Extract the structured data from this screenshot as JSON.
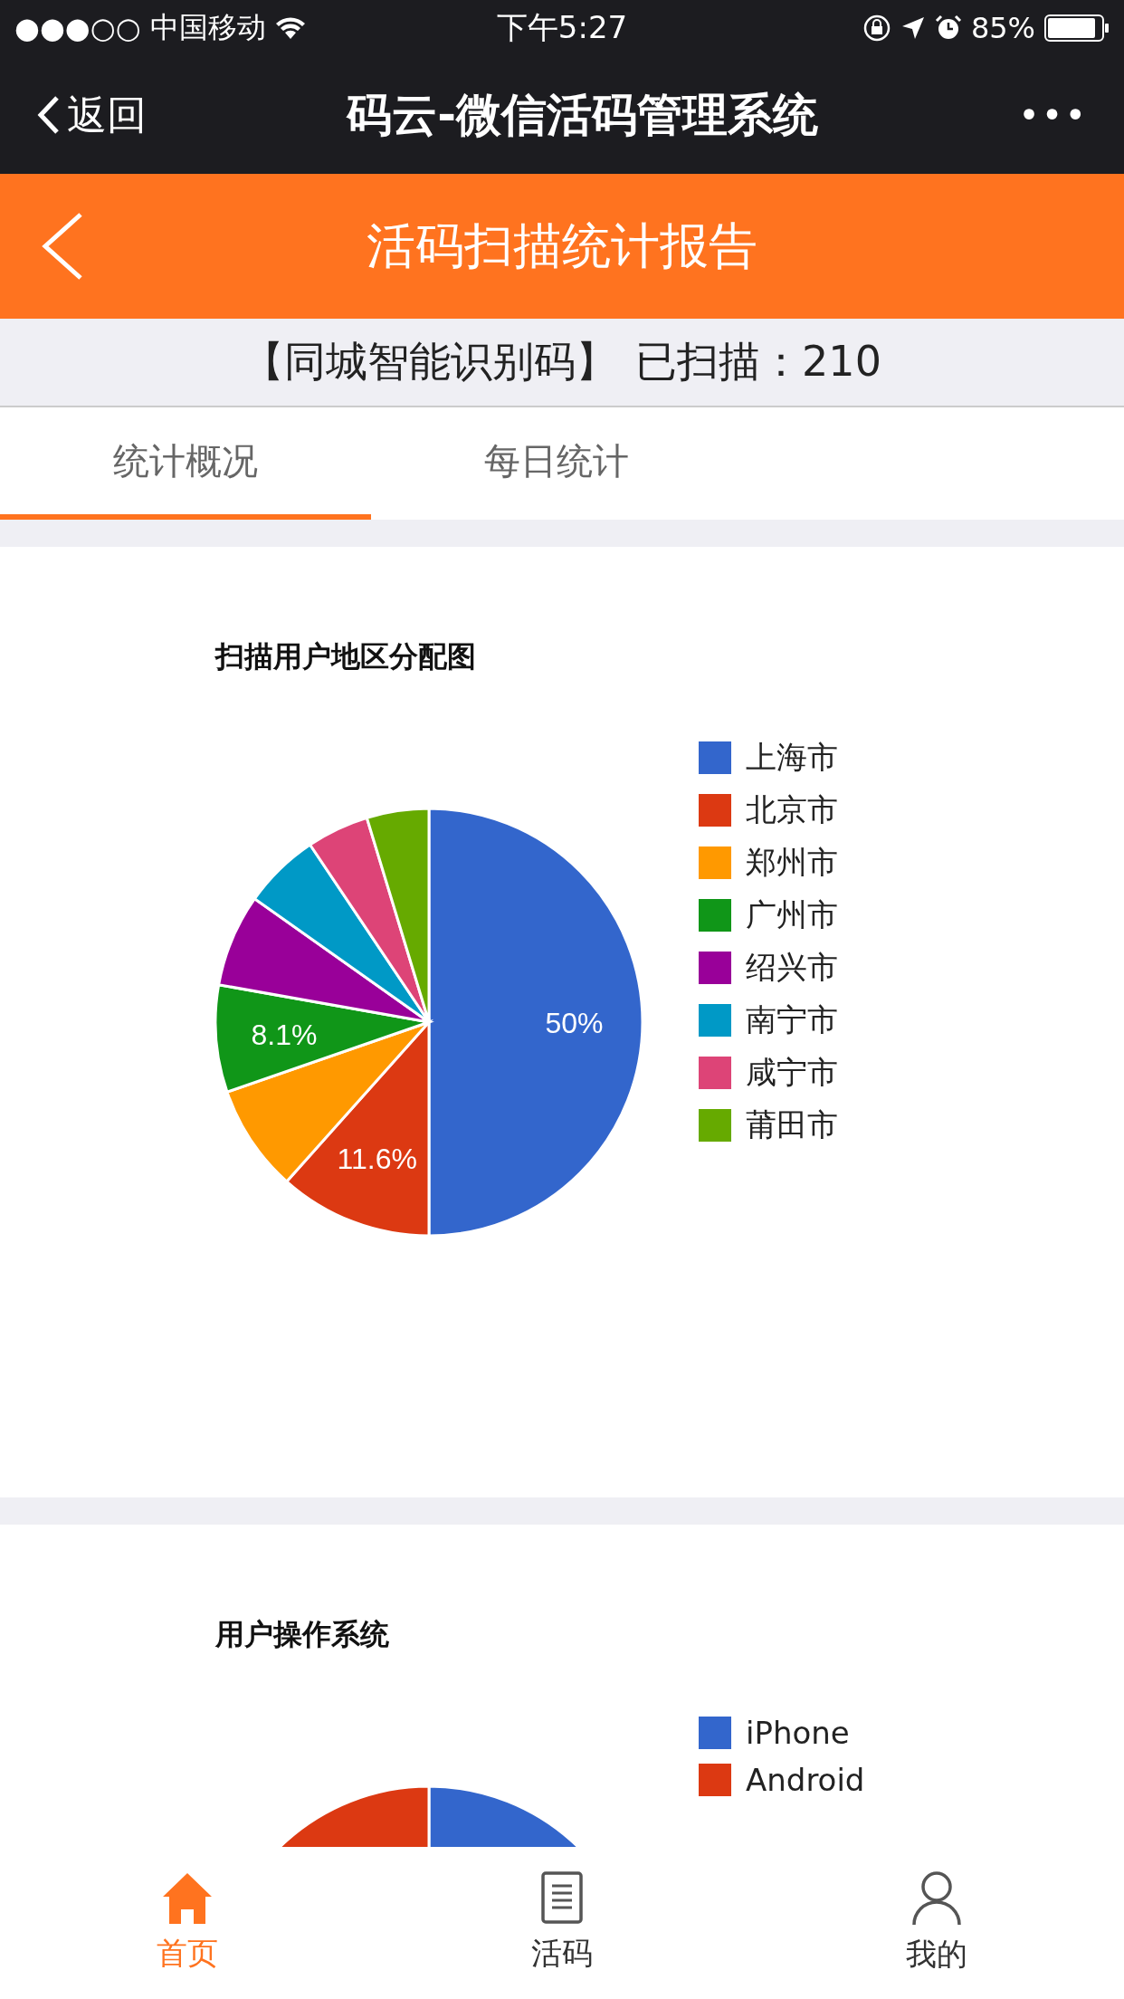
{
  "status_bar": {
    "signal": "●●●○○",
    "carrier": "中国移动",
    "time": "下午5:27",
    "battery": "85%"
  },
  "nav_bar": {
    "back": "返回",
    "title": "码云-微信活码管理系统",
    "more": "•••"
  },
  "header": {
    "title": "活码扫描统计报告"
  },
  "summary": {
    "name": "【同城智能识别码】",
    "label": "已扫描：",
    "count": "210"
  },
  "tabs": [
    {
      "label": "统计概况",
      "selected": true
    },
    {
      "label": "每日统计",
      "selected": false
    }
  ],
  "charts": [
    {
      "chart_data": {
        "type": "pie",
        "title": "扫描用户地区分配图",
        "categories": [
          "上海市",
          "北京市",
          "郑州市",
          "广州市",
          "绍兴市",
          "南宁市",
          "咸宁市",
          "莆田市"
        ],
        "series": [
          {
            "colors": [
              "#3366cc",
              "#dc3912",
              "#ff9900",
              "#109618",
              "#990099",
              "#0099c6",
              "#dd4477",
              "#66aa00"
            ],
            "values": [
              50,
              11.6,
              8.1,
              8.1,
              7,
              5.8,
              4.7,
              4.7
            ]
          }
        ],
        "value_labels": [
          "50%",
          "11.6%",
          null,
          "8.1%",
          null,
          null,
          null,
          null
        ],
        "legend": "right"
      }
    },
    {
      "title": "用户操作系统",
      "legend": [
        {
          "label": "iPhone",
          "color": "#3366cc"
        },
        {
          "label": "Android",
          "color": "#dc3912"
        }
      ]
    }
  ],
  "bottom_nav": [
    {
      "label": "首页",
      "selected": true
    },
    {
      "label": "活码",
      "selected": false
    },
    {
      "label": "我的",
      "selected": false
    }
  ]
}
